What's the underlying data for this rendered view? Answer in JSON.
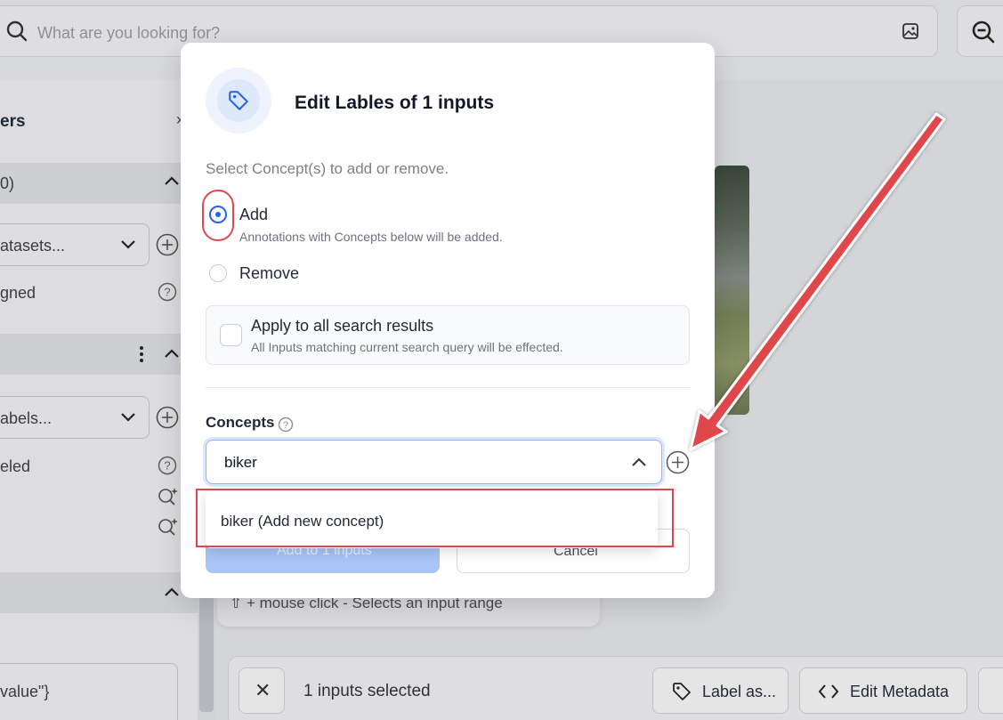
{
  "search": {
    "placeholder": "What are you looking for?"
  },
  "sidebar": {
    "title_fragment": "ers",
    "section1_label": "0)",
    "datasets_select": "atasets...",
    "unassigned_label": "gned",
    "labels_select": "abels...",
    "labeled_label": "eled",
    "metadata_value": "value\"}"
  },
  "content": {
    "hint": "⇧ + mouse click - Selects an input range"
  },
  "bottom_bar": {
    "selected_count": "1 inputs selected",
    "close_symbol": "✕",
    "label_as": "Label as...",
    "edit_metadata": "Edit Metadata"
  },
  "modal": {
    "title": "Edit Lables of 1 inputs",
    "subtitle": "Select Concept(s) to add or remove.",
    "options": [
      {
        "label": "Add",
        "description": "Annotations with Concepts below will be added.",
        "selected": true
      },
      {
        "label": "Remove",
        "description": "",
        "selected": false
      }
    ],
    "apply_all": {
      "label": "Apply to all search results",
      "description": "All Inputs matching current search query will be effected.",
      "checked": false
    },
    "concepts_label": "Concepts",
    "concept_input_value": "biker",
    "dropdown_option": "biker (Add new concept)",
    "primary_button": "Add to 1 inputs",
    "cancel_button": "Cancel"
  },
  "colors": {
    "accent": "#2563eb",
    "annotation_red": "#e0474c"
  }
}
